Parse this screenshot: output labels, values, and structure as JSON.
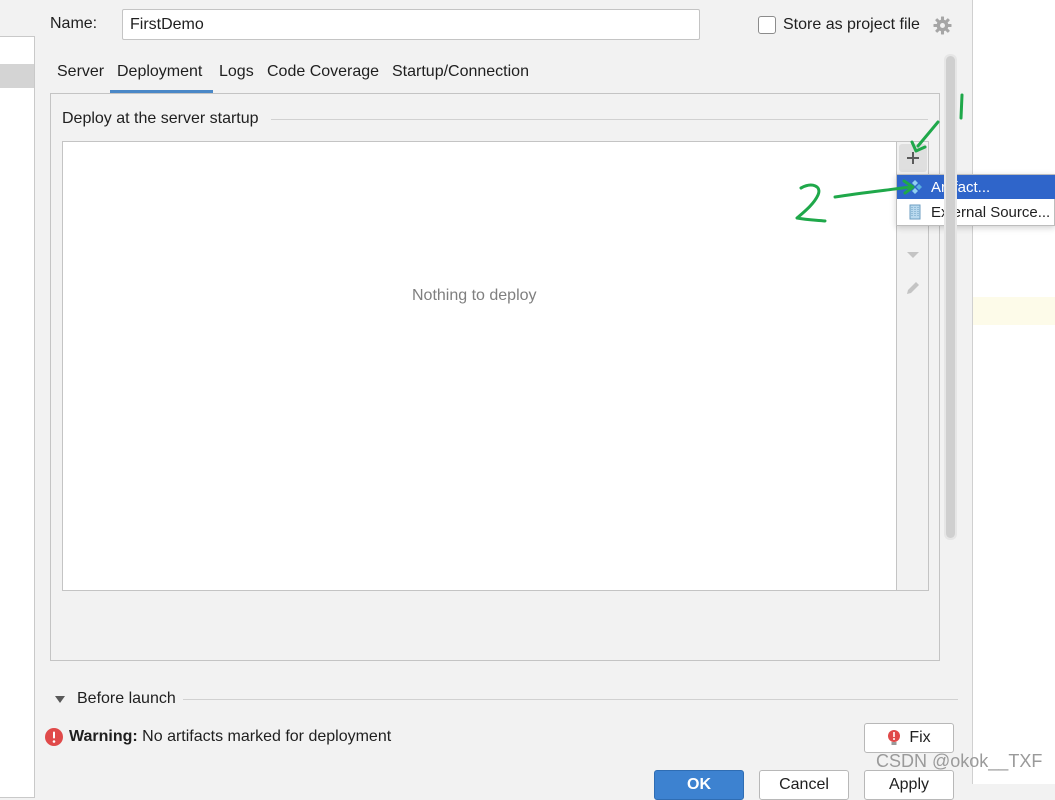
{
  "header": {
    "name_label": "Name:",
    "name_value": "FirstDemo",
    "store_label": "Store as project file",
    "store_checked": false
  },
  "tabs": [
    {
      "label": "Server",
      "active": false
    },
    {
      "label": "Deployment",
      "active": true
    },
    {
      "label": "Logs",
      "active": false
    },
    {
      "label": "Code Coverage",
      "active": false
    },
    {
      "label": "Startup/Connection",
      "active": false
    }
  ],
  "deployment": {
    "section_title": "Deploy at the server startup",
    "empty_text": "Nothing to deploy"
  },
  "popup_menu": {
    "items": [
      {
        "label": "Artifact...",
        "icon": "artifact-icon",
        "selected": true
      },
      {
        "label": "External Source...",
        "icon": "external-source-icon",
        "selected": false
      }
    ]
  },
  "before_launch": {
    "label": "Before launch"
  },
  "warning": {
    "strong": "Warning:",
    "message": " No artifacts marked for deployment"
  },
  "buttons": {
    "fix": "Fix",
    "ok": "OK",
    "cancel": "Cancel",
    "apply": "Apply"
  },
  "annotations": {
    "mark_1": "1",
    "mark_2": "2",
    "color": "#1fa84a"
  },
  "watermark": "CSDN @okok__TXF",
  "colors": {
    "accent": "#4a88c7",
    "menu_selected": "#2f65ca",
    "warning_red": "#e04a4a"
  }
}
